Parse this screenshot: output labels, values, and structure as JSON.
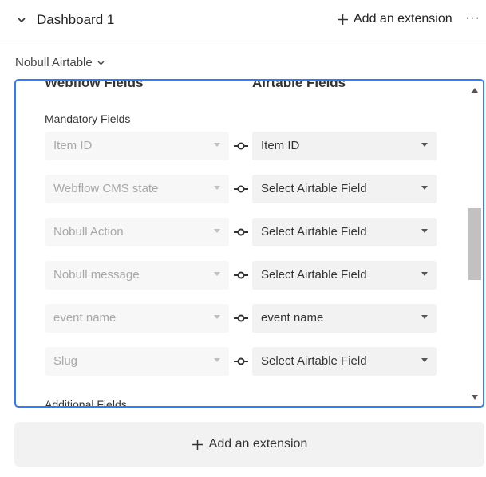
{
  "header": {
    "title": "Dashboard 1",
    "add_extension_label": "Add an extension",
    "more_label": "···"
  },
  "extension": {
    "title": "Nobull Airtable",
    "columns": {
      "left": "Webflow Fields",
      "right": "Airtable Fields"
    },
    "mandatory_label": "Mandatory Fields",
    "additional_label": "Additional Fields",
    "rows": [
      {
        "webflow": "Item ID",
        "airtable": "Item ID"
      },
      {
        "webflow": "Webflow CMS state",
        "airtable": "Select Airtable Field"
      },
      {
        "webflow": "Nobull Action",
        "airtable": "Select Airtable Field"
      },
      {
        "webflow": "Nobull message",
        "airtable": "Select Airtable Field"
      },
      {
        "webflow": "event name",
        "airtable": "event name"
      },
      {
        "webflow": "Slug",
        "airtable": "Select Airtable Field"
      }
    ]
  },
  "footer": {
    "add_extension_label": "Add an extension"
  },
  "icons": {
    "collapse": "chevron-down-icon",
    "add": "plus-icon",
    "link": "link-connector-icon",
    "dropdown": "caret-down-icon"
  },
  "colors": {
    "accent": "#2d7ff9",
    "field_bg": "#f2f2f2",
    "disabled_text": "#a8a8a8"
  }
}
